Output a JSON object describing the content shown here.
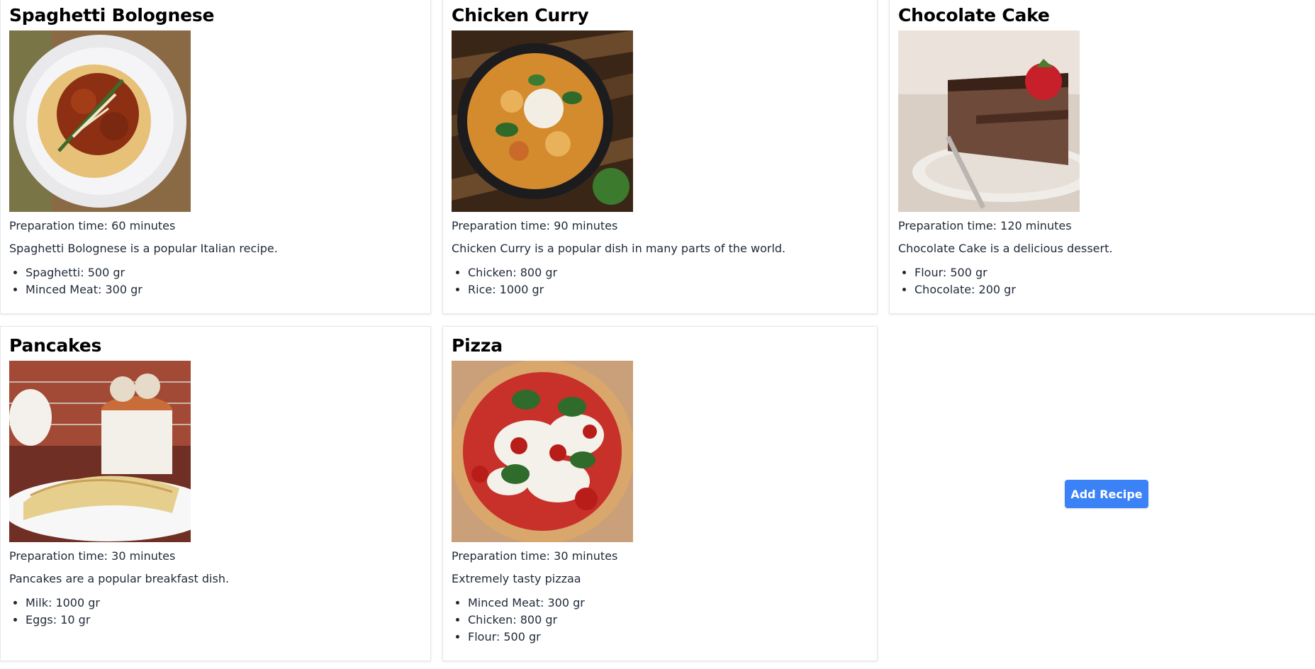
{
  "recipes": [
    {
      "title": "Spaghetti Bolognese",
      "prep": "Preparation time: 60 minutes",
      "description": "Spaghetti Bolognese is a popular Italian recipe.",
      "ingredients": [
        "Spaghetti: 500 gr",
        "Minced Meat: 300 gr"
      ],
      "image": "spaghetti-photo"
    },
    {
      "title": "Chicken Curry",
      "prep": "Preparation time: 90 minutes",
      "description": "Chicken Curry is a popular dish in many parts of the world.",
      "ingredients": [
        "Chicken: 800 gr",
        "Rice: 1000 gr"
      ],
      "image": "curry-photo"
    },
    {
      "title": "Chocolate Cake",
      "prep": "Preparation time: 120 minutes",
      "description": "Chocolate Cake is a delicious dessert.",
      "ingredients": [
        "Flour: 500 gr",
        "Chocolate: 200 gr"
      ],
      "image": "cake-photo"
    },
    {
      "title": "Pancakes",
      "prep": "Preparation time: 30 minutes",
      "description": "Pancakes are a popular breakfast dish.",
      "ingredients": [
        "Milk: 1000 gr",
        "Eggs: 10 gr"
      ],
      "image": "pancakes-photo"
    },
    {
      "title": "Pizza",
      "prep": "Preparation time: 30 minutes",
      "description": "Extremely tasty pizzaa",
      "ingredients": [
        "Minced Meat: 300 gr",
        "Chicken: 800 gr",
        "Flour: 500 gr"
      ],
      "image": "pizza-photo"
    }
  ],
  "actions": {
    "add_recipe_label": "Add Recipe"
  },
  "colors": {
    "accent": "#3b82f6",
    "card_border": "#e5e7eb"
  }
}
